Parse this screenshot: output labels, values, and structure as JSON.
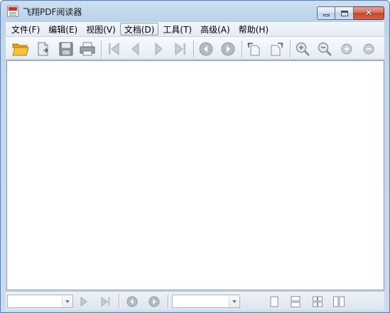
{
  "window": {
    "title": "飞翔PDF阅读器"
  },
  "menu": [
    {
      "label": "文件(F)"
    },
    {
      "label": "编辑(E)"
    },
    {
      "label": "视图(V)"
    },
    {
      "label": "文档(D)",
      "active": true
    },
    {
      "label": "工具(T)"
    },
    {
      "label": "高级(A)"
    },
    {
      "label": "帮助(H)"
    }
  ],
  "toolbar": {
    "icons": [
      "open-folder-icon",
      "open-document-icon",
      "save-icon",
      "print-icon",
      "first-page-icon",
      "previous-page-icon",
      "next-page-icon",
      "last-page-icon",
      "back-icon",
      "forward-icon",
      "rotate-left-icon",
      "rotate-right-icon",
      "zoom-in-icon",
      "zoom-out-icon",
      "zoom-plus-icon",
      "zoom-minus-icon"
    ]
  },
  "statusbar": {
    "page_input": {
      "value": ""
    },
    "zoom_input": {
      "value": ""
    },
    "icons": [
      "next-page-icon",
      "last-page-icon",
      "back-icon",
      "forward-icon",
      "single-page-icon",
      "continuous-page-icon",
      "facing-pages-icon",
      "continuous-facing-icon"
    ]
  },
  "colors": {
    "titlebar": "#b9d1ea",
    "close_button": "#c1442e",
    "accent": "#f5b325"
  }
}
